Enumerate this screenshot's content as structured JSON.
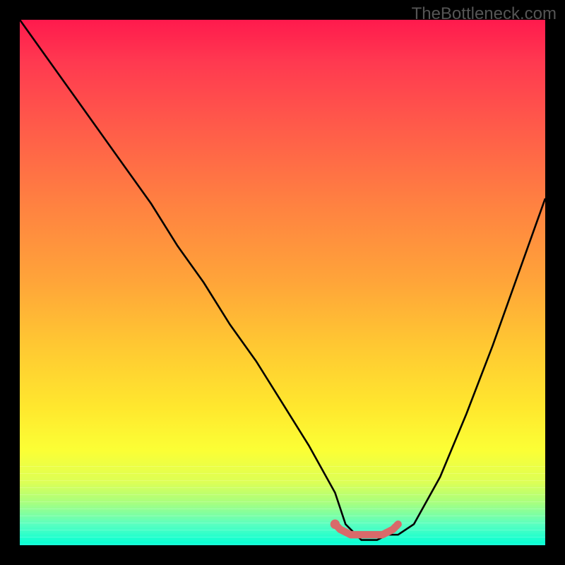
{
  "watermark": "TheBottleneck.com",
  "chart_data": {
    "type": "line",
    "title": "",
    "xlabel": "",
    "ylabel": "",
    "xlim": [
      0,
      100
    ],
    "ylim": [
      0,
      100
    ],
    "series": [
      {
        "name": "curve",
        "x": [
          0,
          5,
          10,
          15,
          20,
          25,
          30,
          35,
          40,
          45,
          50,
          55,
          60,
          62,
          65,
          68,
          70,
          72,
          75,
          80,
          85,
          90,
          95,
          100
        ],
        "values": [
          100,
          93,
          86,
          79,
          72,
          65,
          57,
          50,
          42,
          35,
          27,
          19,
          10,
          4,
          1,
          1,
          2,
          2,
          4,
          13,
          25,
          38,
          52,
          66
        ]
      },
      {
        "name": "marker-band",
        "x": [
          60,
          61,
          63,
          65,
          67,
          69,
          71,
          72
        ],
        "values": [
          4,
          3,
          2,
          2,
          2,
          2,
          3,
          4
        ]
      }
    ],
    "colors": {
      "curve": "#000000",
      "marker": "#d96a6a",
      "gradient_top": "#ff1a4d",
      "gradient_bottom": "#00ffd5"
    }
  }
}
